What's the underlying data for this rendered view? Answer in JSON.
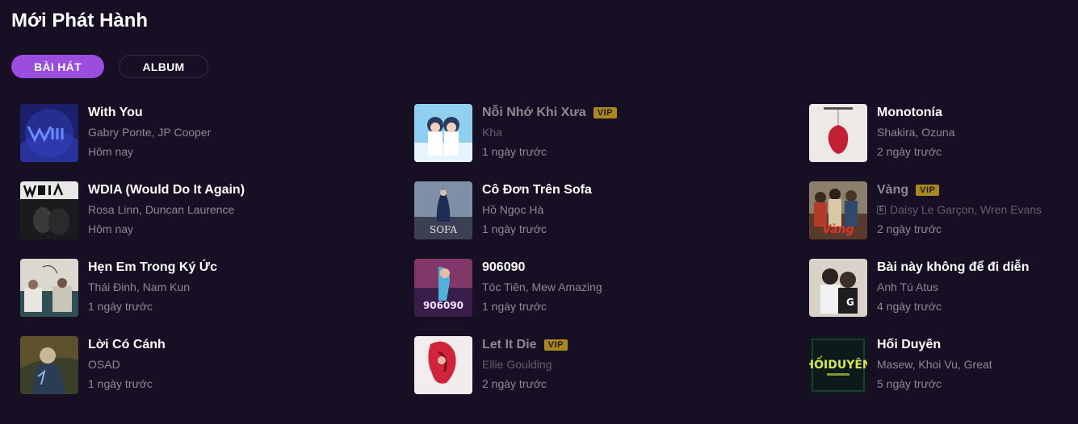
{
  "section": {
    "title": "Mới Phát Hành"
  },
  "tabs": [
    {
      "label": "BÀI HÁT",
      "active": true
    },
    {
      "label": "ALBUM",
      "active": false
    }
  ],
  "songs": [
    {
      "title": "With You",
      "artists": "Gabry Ponte, JP Cooper",
      "time": "Hôm nay",
      "vip": false,
      "thumb_icon": "with-you-cover"
    },
    {
      "title": "WDIA (Would Do It Again)",
      "artists": "Rosa Linn, Duncan Laurence",
      "time": "Hôm nay",
      "vip": false,
      "thumb_icon": "wdia-cover"
    },
    {
      "title": "Hẹn Em Trong Ký Ức",
      "artists": "Thái Đinh, Nam Kun",
      "time": "1 ngày trước",
      "vip": false,
      "thumb_icon": "hen-em-cover"
    },
    {
      "title": "Lời Có Cánh",
      "artists": "OSAD",
      "time": "1 ngày trước",
      "vip": false,
      "thumb_icon": "loi-co-canh-cover"
    },
    {
      "title": "Nỗi Nhớ Khi Xưa",
      "artists": "Kha",
      "time": "1 ngày trước",
      "vip": true,
      "vip_label": "VIP",
      "thumb_icon": "noi-nho-cover"
    },
    {
      "title": "Cô Đơn Trên Sofa",
      "artists": "Hồ Ngọc Hà",
      "time": "1 ngày trước",
      "vip": false,
      "thumb_icon": "co-don-cover"
    },
    {
      "title": "906090",
      "artists": "Tóc Tiên, Mew Amazing",
      "time": "1 ngày trước",
      "vip": false,
      "thumb_icon": "906090-cover"
    },
    {
      "title": "Let It Die",
      "artists": "Ellie Goulding",
      "time": "2 ngày trước",
      "vip": true,
      "vip_label": "VIP",
      "thumb_icon": "let-it-die-cover"
    },
    {
      "title": "Monotonía",
      "artists": "Shakira, Ozuna",
      "time": "2 ngày trước",
      "vip": false,
      "thumb_icon": "monotonia-cover"
    },
    {
      "title": "Vàng",
      "artists": "Daisy Le Garçon, Wren Evans",
      "time": "2 ngày trước",
      "vip": true,
      "vip_label": "VIP",
      "explicit": "E",
      "thumb_icon": "vang-cover"
    },
    {
      "title": "Bài này không để đi diễn",
      "artists": "Anh Tú Atus",
      "time": "4 ngày trước",
      "vip": false,
      "thumb_icon": "bai-nay-cover"
    },
    {
      "title": "Hối Duyên",
      "artists": "Masew, Khoi Vu, Great",
      "time": "5 ngày trước",
      "vip": false,
      "thumb_icon": "hoi-duyen-cover"
    }
  ],
  "colors": {
    "background": "#170f23",
    "accent": "#9b4de0",
    "vip_badge": "#d0a323"
  }
}
